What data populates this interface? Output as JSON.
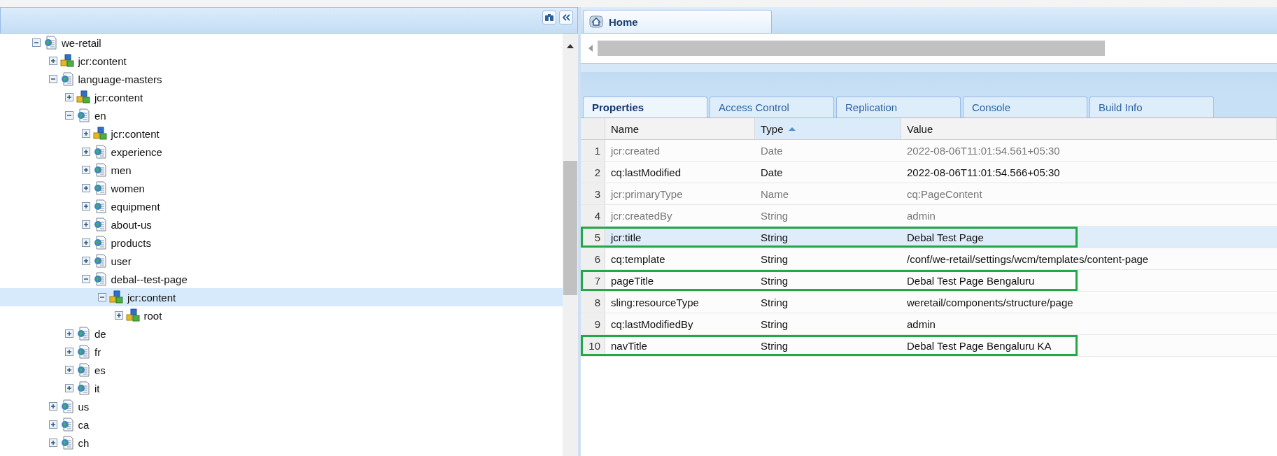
{
  "left_panel": {
    "tree": [
      {
        "label": "we-retail",
        "kind": "page",
        "expanded": true,
        "selected": false,
        "children": [
          {
            "label": "jcr:content",
            "kind": "content",
            "expanded": false,
            "selected": false
          },
          {
            "label": "language-masters",
            "kind": "page",
            "expanded": true,
            "selected": false,
            "children": [
              {
                "label": "jcr:content",
                "kind": "content",
                "expanded": false,
                "selected": false
              },
              {
                "label": "en",
                "kind": "page",
                "expanded": true,
                "selected": false,
                "children": [
                  {
                    "label": "jcr:content",
                    "kind": "content",
                    "expanded": false,
                    "selected": false
                  },
                  {
                    "label": "experience",
                    "kind": "page",
                    "expanded": false,
                    "selected": false
                  },
                  {
                    "label": "men",
                    "kind": "page",
                    "expanded": false,
                    "selected": false
                  },
                  {
                    "label": "women",
                    "kind": "page",
                    "expanded": false,
                    "selected": false
                  },
                  {
                    "label": "equipment",
                    "kind": "page",
                    "expanded": false,
                    "selected": false
                  },
                  {
                    "label": "about-us",
                    "kind": "page",
                    "expanded": false,
                    "selected": false
                  },
                  {
                    "label": "products",
                    "kind": "page",
                    "expanded": false,
                    "selected": false
                  },
                  {
                    "label": "user",
                    "kind": "page",
                    "expanded": false,
                    "selected": false
                  },
                  {
                    "label": "debal--test-page",
                    "kind": "page",
                    "expanded": true,
                    "selected": false,
                    "children": [
                      {
                        "label": "jcr:content",
                        "kind": "content",
                        "expanded": true,
                        "selected": true,
                        "children": [
                          {
                            "label": "root",
                            "kind": "content",
                            "expanded": false,
                            "selected": false
                          }
                        ]
                      }
                    ]
                  }
                ]
              },
              {
                "label": "de",
                "kind": "page",
                "expanded": false,
                "selected": false
              },
              {
                "label": "fr",
                "kind": "page",
                "expanded": false,
                "selected": false
              },
              {
                "label": "es",
                "kind": "page",
                "expanded": false,
                "selected": false
              },
              {
                "label": "it",
                "kind": "page",
                "expanded": false,
                "selected": false
              }
            ]
          },
          {
            "label": "us",
            "kind": "page",
            "expanded": false,
            "selected": false
          },
          {
            "label": "ca",
            "kind": "page",
            "expanded": false,
            "selected": false
          },
          {
            "label": "ch",
            "kind": "page",
            "expanded": false,
            "selected": false
          }
        ]
      }
    ]
  },
  "right_panel": {
    "top_tabs": [
      {
        "label": "Home",
        "selected": true
      }
    ],
    "tabs": [
      {
        "label": "Properties",
        "selected": true
      },
      {
        "label": "Access Control",
        "selected": false
      },
      {
        "label": "Replication",
        "selected": false
      },
      {
        "label": "Console",
        "selected": false
      },
      {
        "label": "Build Info",
        "selected": false
      }
    ],
    "table": {
      "columns": [
        {
          "label": "Name",
          "sorted": false
        },
        {
          "label": "Type",
          "sorted": true
        },
        {
          "label": "Value",
          "sorted": false
        }
      ],
      "rows": [
        {
          "num": "1",
          "name": "jcr:created",
          "type": "Date",
          "value": "2022-08-06T11:01:54.561+05:30",
          "protected": true,
          "selected": false,
          "outlined": false
        },
        {
          "num": "2",
          "name": "cq:lastModified",
          "type": "Date",
          "value": "2022-08-06T11:01:54.566+05:30",
          "protected": false,
          "selected": false,
          "outlined": false
        },
        {
          "num": "3",
          "name": "jcr:primaryType",
          "type": "Name",
          "value": "cq:PageContent",
          "protected": true,
          "selected": false,
          "outlined": false
        },
        {
          "num": "4",
          "name": "jcr:createdBy",
          "type": "String",
          "value": "admin",
          "protected": true,
          "selected": false,
          "outlined": false
        },
        {
          "num": "5",
          "name": "jcr:title",
          "type": "String",
          "value": "Debal Test Page",
          "protected": false,
          "selected": true,
          "outlined": true
        },
        {
          "num": "6",
          "name": "cq:template",
          "type": "String",
          "value": "/conf/we-retail/settings/wcm/templates/content-page",
          "protected": false,
          "selected": false,
          "outlined": false
        },
        {
          "num": "7",
          "name": "pageTitle",
          "type": "String",
          "value": "Debal Test Page Bengaluru",
          "protected": false,
          "selected": false,
          "outlined": true
        },
        {
          "num": "8",
          "name": "sling:resourceType",
          "type": "String",
          "value": "weretail/components/structure/page",
          "protected": false,
          "selected": false,
          "outlined": false
        },
        {
          "num": "9",
          "name": "cq:lastModifiedBy",
          "type": "String",
          "value": "admin",
          "protected": false,
          "selected": false,
          "outlined": false
        },
        {
          "num": "10",
          "name": "navTitle",
          "type": "String",
          "value": "Debal Test Page Bengaluru KA",
          "protected": false,
          "selected": false,
          "outlined": true
        }
      ]
    }
  }
}
